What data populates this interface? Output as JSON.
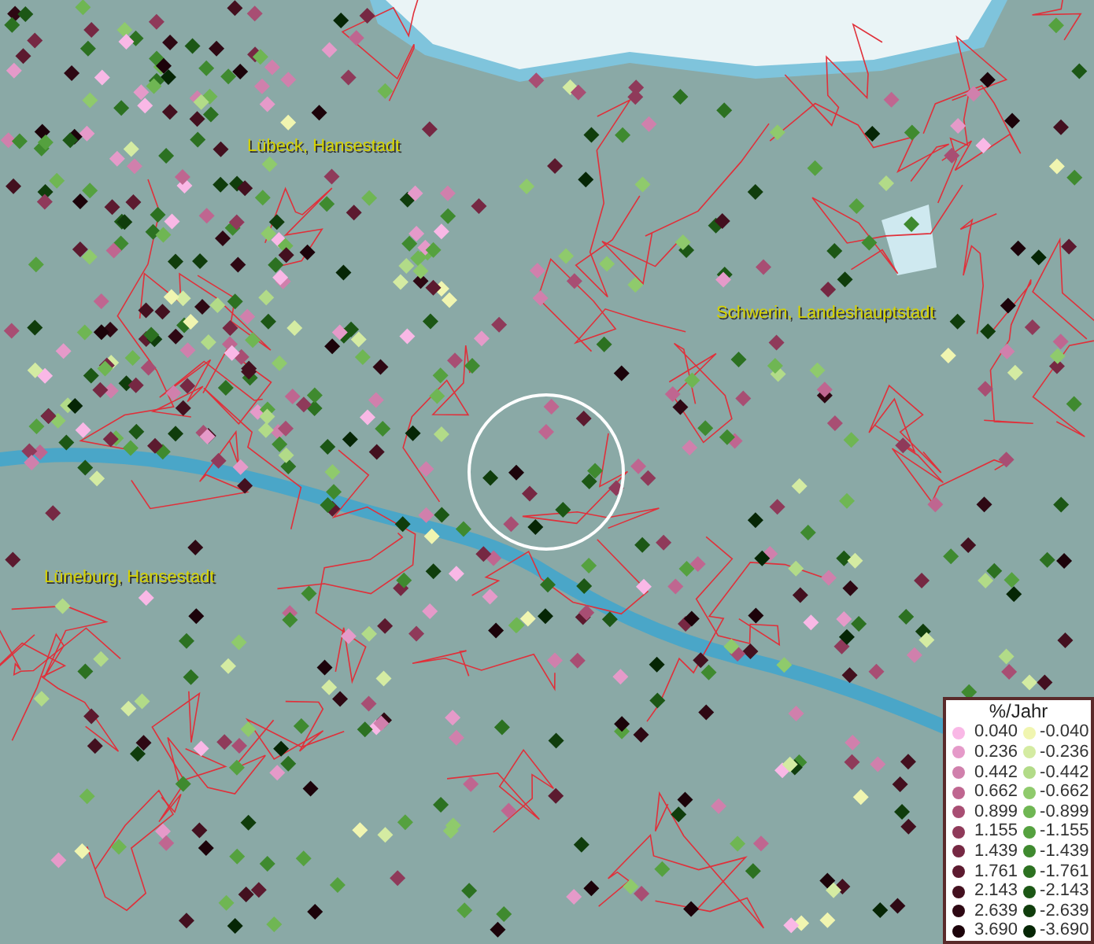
{
  "map": {
    "place_labels": [
      {
        "text": "Lübeck, Hansestadt"
      },
      {
        "text": "Schwerin, Landeshauptstadt"
      },
      {
        "text": "Lüneburg, Hansestadt"
      }
    ]
  },
  "legend": {
    "title": "%/Jahr",
    "positive": [
      {
        "value": "0.040",
        "color": "#f9b8e6"
      },
      {
        "value": "0.236",
        "color": "#e59ac9"
      },
      {
        "value": "0.442",
        "color": "#d080ac"
      },
      {
        "value": "0.662",
        "color": "#bf6690"
      },
      {
        "value": "0.899",
        "color": "#a84e73"
      },
      {
        "value": "1.155",
        "color": "#8f3a5a"
      },
      {
        "value": "1.439",
        "color": "#762843"
      },
      {
        "value": "1.761",
        "color": "#5c1a2f"
      },
      {
        "value": "2.143",
        "color": "#43101f"
      },
      {
        "value": "2.639",
        "color": "#2e0813"
      },
      {
        "value": "3.690",
        "color": "#1c030a"
      }
    ],
    "negative": [
      {
        "value": "-0.040",
        "color": "#f0f5b0"
      },
      {
        "value": "-0.236",
        "color": "#d4eba2"
      },
      {
        "value": "-0.442",
        "color": "#b2db88"
      },
      {
        "value": "-0.662",
        "color": "#8fca6c"
      },
      {
        "value": "-0.899",
        "color": "#6fb653"
      },
      {
        "value": "-1.155",
        "color": "#55a13f"
      },
      {
        "value": "-1.439",
        "color": "#3f8a2f"
      },
      {
        "value": "-1.761",
        "color": "#2c7121"
      },
      {
        "value": "-2.143",
        "color": "#1c5715"
      },
      {
        "value": "-2.639",
        "color": "#103d0c"
      },
      {
        "value": "-3.690",
        "color": "#062605"
      }
    ]
  }
}
